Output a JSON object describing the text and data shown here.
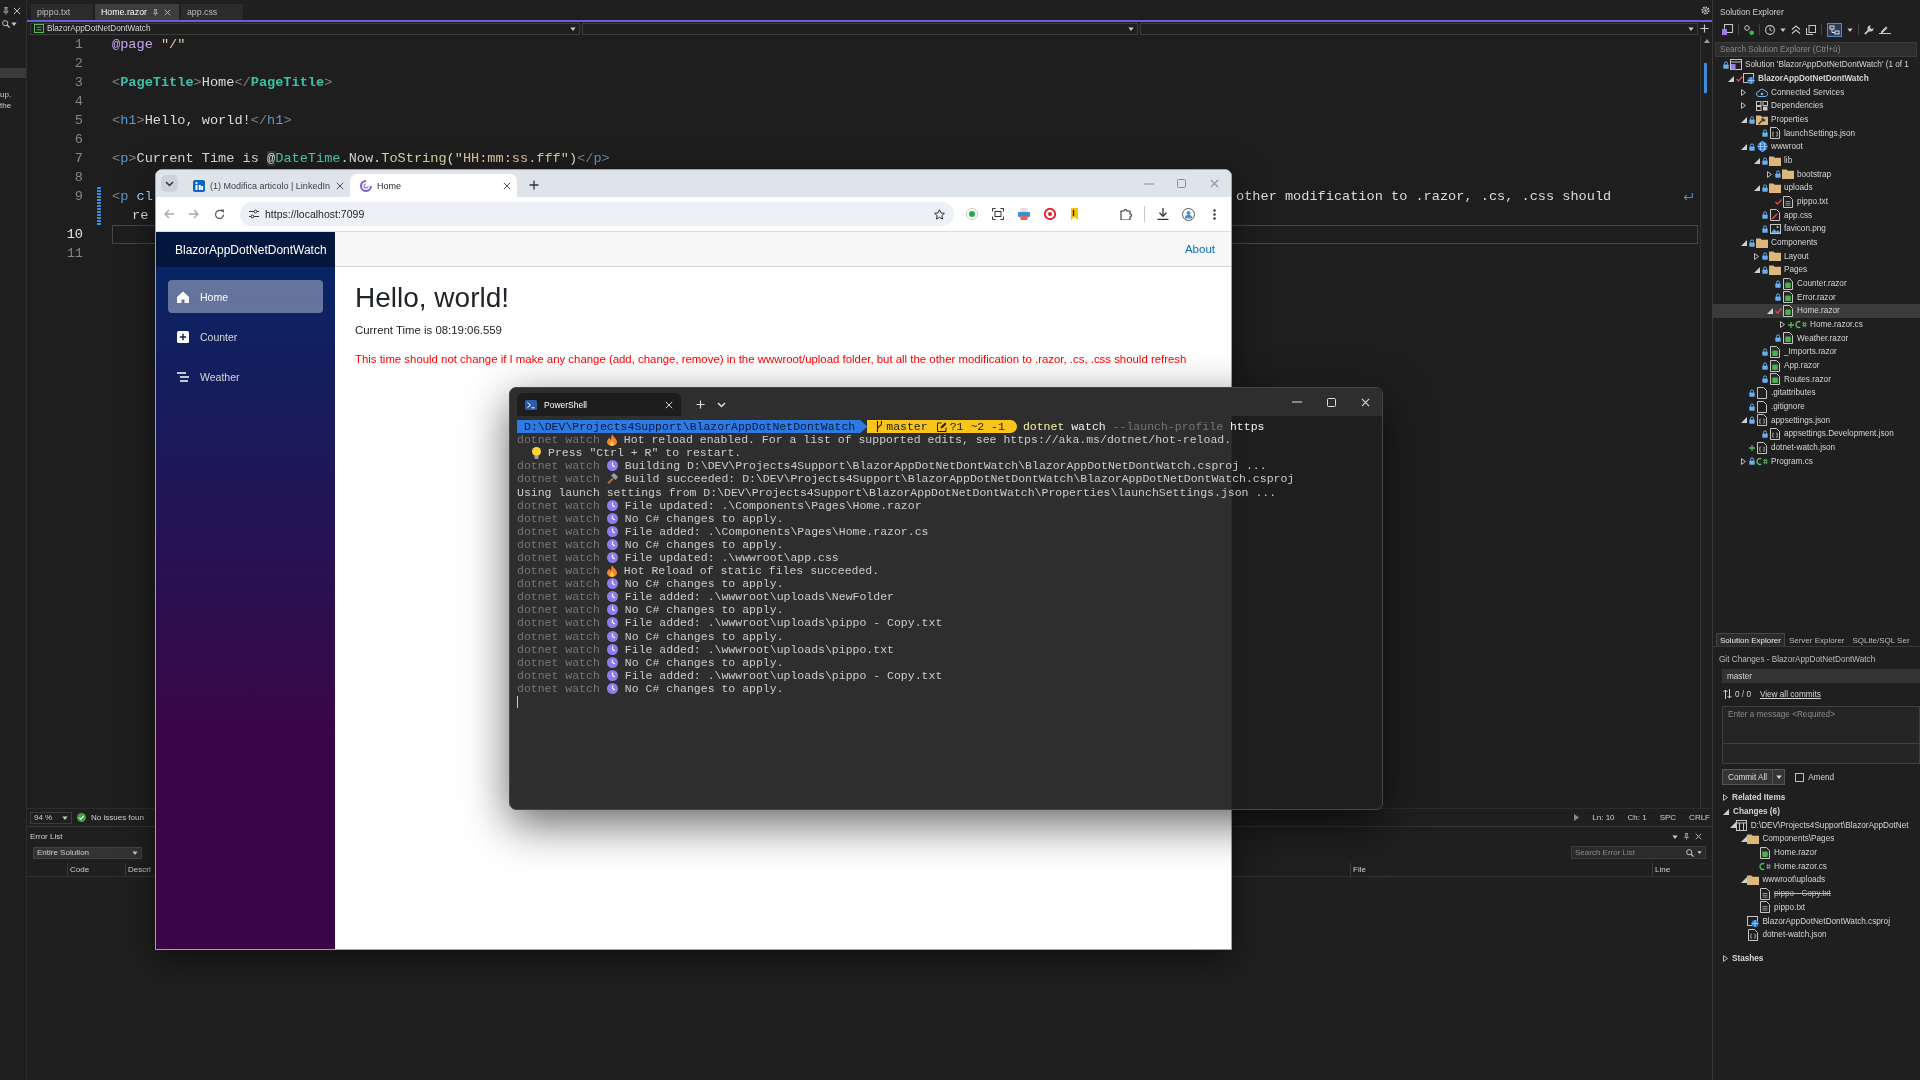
{
  "left_strip": {
    "lines": [
      "up.",
      "the"
    ]
  },
  "editor": {
    "tabs": [
      {
        "label": "pippo.txt",
        "selected": false,
        "pinned": false
      },
      {
        "label": "Home.razor",
        "selected": true,
        "pinned": true
      },
      {
        "label": "app.css",
        "selected": false,
        "pinned": false
      }
    ],
    "project": "BlazorAppDotNetDontWatch",
    "lines": [
      {
        "number": "1",
        "current": false,
        "modified": false,
        "tokens": [
          {
            "kind": "directive",
            "text": "@page"
          },
          {
            "kind": "string",
            "text": " \"/\""
          }
        ]
      },
      {
        "number": "2",
        "current": false,
        "modified": false
      },
      {
        "number": "3",
        "current": false,
        "modified": false,
        "tokens": [
          {
            "kind": "punct",
            "text": "<"
          },
          {
            "kind": "component",
            "text": "PageTitle"
          },
          {
            "kind": "punct",
            "text": ">"
          },
          {
            "kind": "text",
            "text": "Home"
          },
          {
            "kind": "punct",
            "text": "</"
          },
          {
            "kind": "component",
            "text": "PageTitle"
          },
          {
            "kind": "punct",
            "text": ">"
          }
        ]
      },
      {
        "number": "4",
        "current": false,
        "modified": false
      },
      {
        "number": "5",
        "current": false,
        "modified": false,
        "tokens": [
          {
            "kind": "punct",
            "text": "<"
          },
          {
            "kind": "tag",
            "text": "h1"
          },
          {
            "kind": "punct",
            "text": ">"
          },
          {
            "kind": "text",
            "text": "Hello, world!"
          },
          {
            "kind": "punct",
            "text": "</"
          },
          {
            "kind": "tag",
            "text": "h1"
          },
          {
            "kind": "punct",
            "text": ">"
          }
        ]
      },
      {
        "number": "6",
        "current": false,
        "modified": false
      },
      {
        "number": "7",
        "current": false,
        "modified": false,
        "tokens": [
          {
            "kind": "punct",
            "text": "<"
          },
          {
            "kind": "tag",
            "text": "p"
          },
          {
            "kind": "punct",
            "text": ">"
          },
          {
            "kind": "text",
            "text": "Current Time is "
          },
          {
            "kind": "razor",
            "text": "@"
          },
          {
            "kind": "type",
            "text": "DateTime"
          },
          {
            "kind": "text",
            "text": ".Now."
          },
          {
            "kind": "method",
            "text": "ToString"
          },
          {
            "kind": "text",
            "text": "("
          },
          {
            "kind": "string",
            "text": "\"HH:mm:ss.fff\""
          },
          {
            "kind": "text",
            "text": ")"
          },
          {
            "kind": "punct",
            "text": "</"
          },
          {
            "kind": "tag",
            "text": "p"
          },
          {
            "kind": "punct",
            "text": ">"
          }
        ]
      },
      {
        "number": "8",
        "current": false,
        "modified": false
      },
      {
        "number": "9",
        "current": false,
        "modified": true,
        "tokens": [
          {
            "kind": "punct",
            "text": "<"
          },
          {
            "kind": "tag",
            "text": "p"
          },
          {
            "kind": "attr",
            "text": " cl"
          }
        ],
        "tokens_right": [
          {
            "kind": "text",
            "text": "other modification to .razor, .cs, .css should"
          }
        ],
        "wrap": [
          {
            "kind": "text",
            "text": "re"
          }
        ]
      },
      {
        "number": "10",
        "current": true,
        "modified": false
      },
      {
        "number": "11",
        "current": false,
        "modified": false
      }
    ],
    "zoom": "94 %",
    "issues": "No issues foun",
    "caret_line": "Ln: 10",
    "caret_char": "Ch: 1",
    "indent": "SPC",
    "line_ending": "CRLF"
  },
  "error_list": {
    "title": "Error List",
    "scope": "Entire Solution",
    "search": {
      "placeholder": "Search Error List"
    },
    "columns": [
      "Code",
      "Descri",
      "File",
      "Line"
    ]
  },
  "solution_explorer": {
    "title": "Solution Explorer",
    "search": {
      "placeholder": "Search Solution Explorer (Ctrl+ù)"
    },
    "tree": [
      {
        "label": "Solution 'BlazorAppDotNetDontWatch' (1 of 1",
        "kind": "solution",
        "git": {
          "kind": "locked"
        },
        "selected": false,
        "children": [
          {
            "label": "BlazorAppDotNetDontWatch",
            "kind": "project",
            "git": {
              "kind": "modified"
            },
            "expanded": true,
            "selected": false,
            "children": [
              {
                "label": "Connected Services",
                "kind": "service",
                "expanded": false,
                "selected": false
              },
              {
                "label": "Dependencies",
                "kind": "dependencies",
                "expanded": false,
                "selected": false
              },
              {
                "label": "Properties",
                "kind": "properties",
                "git": {
                  "kind": "locked"
                },
                "expanded": true,
                "selected": false,
                "children": [
                  {
                    "label": "launchSettings.json",
                    "kind": "json",
                    "git": {
                      "kind": "locked"
                    },
                    "selected": false
                  }
                ]
              },
              {
                "label": "wwwroot",
                "kind": "web",
                "git": {
                  "kind": "locked"
                },
                "expanded": true,
                "selected": false,
                "children": [
                  {
                    "label": "lib",
                    "kind": "folder",
                    "git": {
                      "kind": "locked"
                    },
                    "expanded": true,
                    "selected": false,
                    "children": [
                      {
                        "label": "bootstrap",
                        "kind": "folder",
                        "git": {
                          "kind": "locked"
                        },
                        "expanded": false,
                        "selected": false
                      }
                    ]
                  },
                  {
                    "label": "uploads",
                    "kind": "folder",
                    "git": {
                      "kind": "locked"
                    },
                    "expanded": true,
                    "selected": false,
                    "children": [
                      {
                        "label": "pippo.txt",
                        "kind": "text",
                        "git": {
                          "kind": "modified"
                        },
                        "selected": false
                      }
                    ]
                  },
                  {
                    "label": "app.css",
                    "kind": "css",
                    "git": {
                      "kind": "locked"
                    },
                    "selected": false
                  },
                  {
                    "label": "favicon.png",
                    "kind": "image",
                    "git": {
                      "kind": "locked"
                    },
                    "selected": false
                  }
                ]
              },
              {
                "label": "Components",
                "kind": "folder",
                "git": {
                  "kind": "locked"
                },
                "expanded": true,
                "selected": false,
                "children": [
                  {
                    "label": "Layout",
                    "kind": "folder",
                    "git": {
                      "kind": "locked"
                    },
                    "expanded": false,
                    "selected": false
                  },
                  {
                    "label": "Pages",
                    "kind": "folder",
                    "git": {
                      "kind": "locked"
                    },
                    "expanded": true,
                    "selected": false,
                    "children": [
                      {
                        "label": "Counter.razor",
                        "kind": "razor",
                        "git": {
                          "kind": "locked"
                        },
                        "selected": false
                      },
                      {
                        "label": "Error.razor",
                        "kind": "razor",
                        "git": {
                          "kind": "locked"
                        },
                        "selected": false
                      },
                      {
                        "label": "Home.razor",
                        "kind": "razor",
                        "git": {
                          "kind": "modified"
                        },
                        "expanded": true,
                        "selected": true,
                        "children": [
                          {
                            "label": "Home.razor.cs",
                            "kind": "csharp",
                            "git": {
                              "kind": "added"
                            },
                            "expanded": false,
                            "selected": false
                          }
                        ]
                      },
                      {
                        "label": "Weather.razor",
                        "kind": "razor",
                        "git": {
                          "kind": "locked"
                        },
                        "selected": false
                      }
                    ]
                  },
                  {
                    "label": "_Imports.razor",
                    "kind": "razor",
                    "git": {
                      "kind": "locked"
                    },
                    "selected": false
                  },
                  {
                    "label": "App.razor",
                    "kind": "razor",
                    "git": {
                      "kind": "locked"
                    },
                    "selected": false
                  },
                  {
                    "label": "Routes.razor",
                    "kind": "razor",
                    "git": {
                      "kind": "locked"
                    },
                    "selected": false
                  }
                ]
              },
              {
                "label": ".gitattributes",
                "kind": "file",
                "git": {
                  "kind": "locked"
                },
                "selected": false
              },
              {
                "label": ".gitignore",
                "kind": "file",
                "git": {
                  "kind": "locked"
                },
                "selected": false
              },
              {
                "label": "appsettings.json",
                "kind": "json",
                "git": {
                  "kind": "locked"
                },
                "expanded": true,
                "selected": false,
                "children": [
                  {
                    "label": "appsettings.Development.json",
                    "kind": "json",
                    "git": {
                      "kind": "locked"
                    },
                    "selected": false
                  }
                ]
              },
              {
                "label": "dotnet-watch.json",
                "kind": "json",
                "git": {
                  "kind": "added"
                },
                "selected": false
              },
              {
                "label": "Program.cs",
                "kind": "csharp",
                "git": {
                  "kind": "locked"
                },
                "expanded": false,
                "selected": false
              }
            ]
          }
        ]
      }
    ],
    "tabs": [
      {
        "label": "Solution Explorer",
        "selected": true
      },
      {
        "label": "Server Explorer",
        "selected": false
      },
      {
        "label": "SQLite/SQL Ser",
        "selected": false
      }
    ]
  },
  "git_changes": {
    "title": "Git Changes - BlazorAppDotNetDontWatch",
    "branch": "master",
    "sync": "0 / 0",
    "history_link": "View all commits",
    "message": {
      "placeholder": "Enter a message <Required>"
    },
    "commit_button": "Commit All",
    "amend": {
      "label": "Amend",
      "checked": false
    },
    "sections": [
      {
        "label": "Related Items",
        "expanded": false
      },
      {
        "label": "Changes (6)",
        "expanded": true,
        "children": [
          {
            "label": "D:\\DEV\\Projects4Support\\BlazorAppDotNet",
            "kind": "repo",
            "expanded": true,
            "children": [
              {
                "label": "Components\\Pages",
                "kind": "folder",
                "expanded": true,
                "children": [
                  {
                    "label": "Home.razor",
                    "kind": "razor",
                    "deleted": false
                  },
                  {
                    "label": "Home.razor.cs",
                    "kind": "csharp",
                    "deleted": false
                  }
                ]
              },
              {
                "label": "wwwroot\\uploads",
                "kind": "folder",
                "expanded": true,
                "children": [
                  {
                    "label": "pippo - Copy.txt",
                    "kind": "text",
                    "deleted": true
                  },
                  {
                    "label": "pippo.txt",
                    "kind": "text",
                    "deleted": false
                  }
                ]
              },
              {
                "label": "BlazorAppDotNetDontWatch.csproj",
                "kind": "project",
                "deleted": false
              },
              {
                "label": "dotnet-watch.json",
                "kind": "json",
                "deleted": false
              }
            ]
          }
        ]
      },
      {
        "label": "Stashes",
        "expanded": false
      }
    ]
  },
  "browser": {
    "tabs": [
      {
        "title": "(1) Modifica articolo | LinkedIn",
        "kind": "linkedin",
        "selected": false
      },
      {
        "title": "Home",
        "kind": "blazor",
        "selected": true
      }
    ],
    "url": "https://localhost:7099",
    "page": {
      "brand": "BlazorAppDotNetDontWatch",
      "nav": [
        {
          "label": "Home",
          "kind": "home",
          "selected": true
        },
        {
          "label": "Counter",
          "kind": "plus",
          "selected": false
        },
        {
          "label": "Weather",
          "kind": "list",
          "selected": false
        }
      ],
      "top_link": "About",
      "heading": "Hello, world!",
      "time": "Current Time is 08:19:06.559",
      "note": "This time should not change if I make any change (add, change, remove) in the wwwroot/upload folder, but all the other modification to .razor, .cs, .css should refresh"
    }
  },
  "terminal": {
    "tab": "PowerShell",
    "prompt": {
      "path": "D:\\DEV\\Projects4Support\\BlazorAppDotNetDontWatch",
      "branch": "master",
      "status": "?1 ~2 -1",
      "command": [
        {
          "kind": "program",
          "text": "dotnet"
        },
        {
          "kind": "argument",
          "text": "watch"
        },
        {
          "kind": "option",
          "text": "--launch-profile"
        },
        {
          "kind": "argument",
          "text": "https"
        }
      ]
    },
    "lines": [
      {
        "kind": "hotreload",
        "prefix": "dotnet watch",
        "text": "Hot reload enabled. For a list of supported edits, see https://aka.ms/dotnet/hot-reload."
      },
      {
        "kind": "hint",
        "text": "Press \"Ctrl + R\" to restart."
      },
      {
        "kind": "info",
        "prefix": "dotnet watch",
        "text": "Building D:\\DEV\\Projects4Support\\BlazorAppDotNetDontWatch\\BlazorAppDotNetDontWatch.csproj ..."
      },
      {
        "kind": "success",
        "prefix": "dotnet watch",
        "text": "Build succeeded: D:\\DEV\\Projects4Support\\BlazorAppDotNetDontWatch\\BlazorAppDotNetDontWatch.csproj"
      },
      {
        "kind": "plain",
        "text": "Using launch settings from D:\\DEV\\Projects4Support\\BlazorAppDotNetDontWatch\\Properties\\launchSettings.json ..."
      },
      {
        "kind": "info",
        "prefix": "dotnet watch",
        "text": "File updated: .\\Components\\Pages\\Home.razor"
      },
      {
        "kind": "info",
        "prefix": "dotnet watch",
        "text": "No C# changes to apply."
      },
      {
        "kind": "info",
        "prefix": "dotnet watch",
        "text": "File added: .\\Components\\Pages\\Home.razor.cs"
      },
      {
        "kind": "info",
        "prefix": "dotnet watch",
        "text": "No C# changes to apply."
      },
      {
        "kind": "info",
        "prefix": "dotnet watch",
        "text": "File updated: .\\wwwroot\\app.css"
      },
      {
        "kind": "hotreload",
        "prefix": "dotnet watch",
        "text": "Hot Reload of static files succeeded."
      },
      {
        "kind": "info",
        "prefix": "dotnet watch",
        "text": "No C# changes to apply."
      },
      {
        "kind": "info",
        "prefix": "dotnet watch",
        "text": "File added: .\\wwwroot\\uploads\\NewFolder"
      },
      {
        "kind": "info",
        "prefix": "dotnet watch",
        "text": "No C# changes to apply."
      },
      {
        "kind": "info",
        "prefix": "dotnet watch",
        "text": "File added: .\\wwwroot\\uploads\\pippo - Copy.txt"
      },
      {
        "kind": "info",
        "prefix": "dotnet watch",
        "text": "No C# changes to apply."
      },
      {
        "kind": "info",
        "prefix": "dotnet watch",
        "text": "File added: .\\wwwroot\\uploads\\pippo.txt"
      },
      {
        "kind": "info",
        "prefix": "dotnet watch",
        "text": "No C# changes to apply."
      },
      {
        "kind": "info",
        "prefix": "dotnet watch",
        "text": "File added: .\\wwwroot\\uploads\\pippo - Copy.txt"
      },
      {
        "kind": "info",
        "prefix": "dotnet watch",
        "text": "No C# changes to apply."
      }
    ]
  }
}
